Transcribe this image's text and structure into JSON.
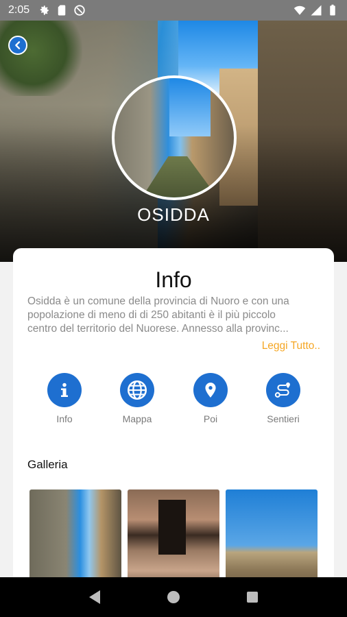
{
  "status_bar": {
    "time": "2:05",
    "left_icons": [
      "settings-icon",
      "sim-card-icon",
      "do-not-disturb-icon"
    ],
    "right_icons": [
      "wifi-icon",
      "signal-icon",
      "battery-icon"
    ]
  },
  "hero": {
    "town_name": "OSIDDA",
    "back_icon": "chevron-left-icon"
  },
  "info": {
    "title": "Info",
    "description_lines": [
      "Osidda è un comune della provincia di Nuoro e con una",
      "popolazione di meno di di 250 abitanti è il più piccolo",
      "centro del territorio del Nuorese. Annesso alla provinc..."
    ],
    "read_more": "Leggi Tutto.."
  },
  "actions": [
    {
      "label": "Info",
      "icon": "info-icon"
    },
    {
      "label": "Mappa",
      "icon": "globe-icon"
    },
    {
      "label": "Poi",
      "icon": "map-pin-icon"
    },
    {
      "label": "Sentieri",
      "icon": "route-icon"
    }
  ],
  "gallery": {
    "title": "Galleria",
    "images": [
      "street-photo",
      "stone-wall-photo",
      "nuraghe-photo"
    ]
  },
  "nav_bar": {
    "buttons": [
      "back-triangle-icon",
      "home-circle-icon",
      "recents-square-icon"
    ]
  },
  "colors": {
    "accent_blue": "#1e6fd0",
    "read_more": "#f5a623",
    "status_bar": "#7b7b7b",
    "text_muted": "#8a8a8a"
  }
}
